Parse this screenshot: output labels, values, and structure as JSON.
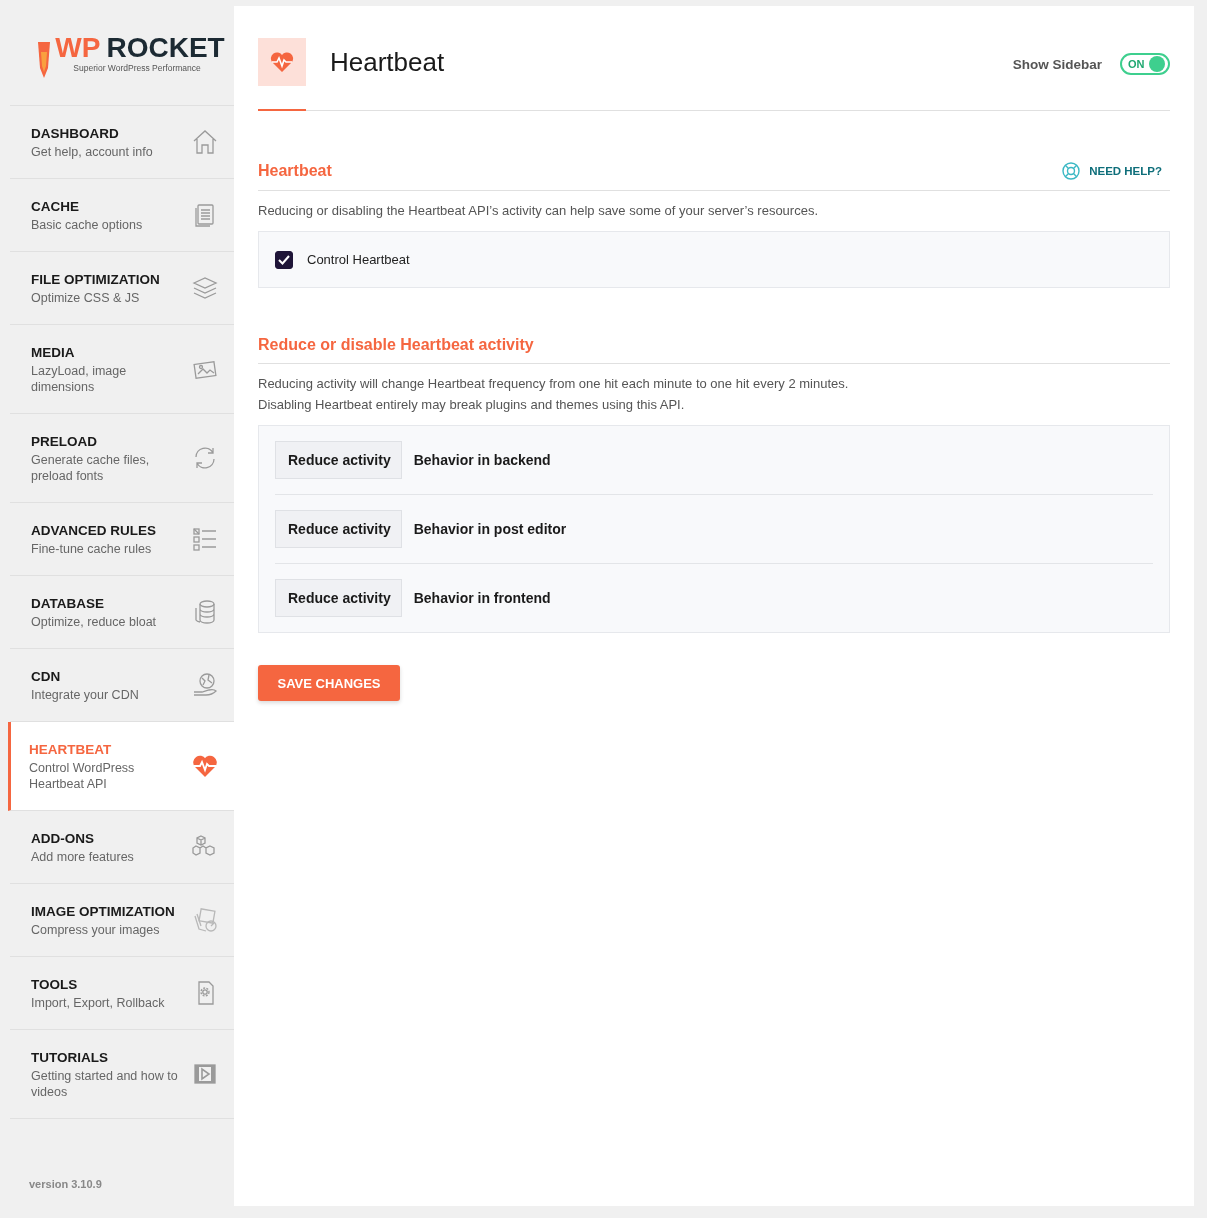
{
  "logo": {
    "mark": "WP",
    "name": "ROCKET",
    "tagline": "Superior WordPress Performance"
  },
  "sidebar": {
    "items": [
      {
        "title": "DASHBOARD",
        "description": "Get help, account info",
        "selected": false
      },
      {
        "title": "CACHE",
        "description": "Basic cache options",
        "selected": false
      },
      {
        "title": "FILE OPTIMIZATION",
        "description": "Optimize CSS & JS",
        "selected": false
      },
      {
        "title": "MEDIA",
        "description": "LazyLoad, image dimensions",
        "selected": false
      },
      {
        "title": "PRELOAD",
        "description": "Generate cache files, preload fonts",
        "selected": false
      },
      {
        "title": "ADVANCED RULES",
        "description": "Fine-tune cache rules",
        "selected": false
      },
      {
        "title": "DATABASE",
        "description": "Optimize, reduce bloat",
        "selected": false
      },
      {
        "title": "CDN",
        "description": "Integrate your CDN",
        "selected": false
      },
      {
        "title": "HEARTBEAT",
        "description": "Control WordPress Heartbeat API",
        "selected": true
      },
      {
        "title": "ADD-ONS",
        "description": "Add more features",
        "selected": false
      },
      {
        "title": "IMAGE OPTIMIZATION",
        "description": "Compress your images",
        "selected": false
      },
      {
        "title": "TOOLS",
        "description": "Import, Export, Rollback",
        "selected": false
      },
      {
        "title": "TUTORIALS",
        "description": "Getting started and how to videos",
        "selected": false
      }
    ],
    "version": "version 3.10.9"
  },
  "header": {
    "title": "Heartbeat",
    "sidebar_toggle": {
      "label": "Show Sidebar",
      "state_text": "ON",
      "on": true
    }
  },
  "sections": [
    {
      "title": "Heartbeat",
      "help": "NEED HELP?",
      "description": [
        "Reducing or disabling the Heartbeat API’s activity can help save some of your server’s resources."
      ],
      "options": [
        {
          "kind": "checkbox",
          "label": "Control Heartbeat",
          "checked": true
        }
      ]
    },
    {
      "title": "Reduce or disable Heartbeat activity",
      "description": [
        "Reducing activity will change Heartbeat frequency from one hit each minute to one hit every 2 minutes.",
        "Disabling Heartbeat entirely may break plugins and themes using this API."
      ],
      "options": [
        {
          "kind": "select",
          "value": "Reduce activity",
          "label": "Behavior in backend"
        },
        {
          "kind": "select",
          "value": "Reduce activity",
          "label": "Behavior in post editor"
        },
        {
          "kind": "select",
          "value": "Reduce activity",
          "label": "Behavior in frontend"
        }
      ]
    }
  ],
  "save_button": "SAVE CHANGES"
}
